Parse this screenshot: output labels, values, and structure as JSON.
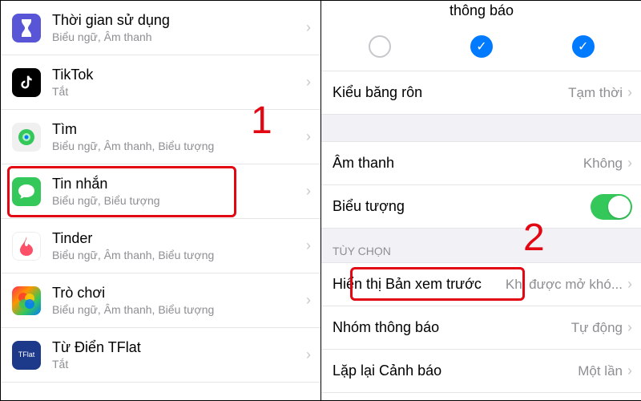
{
  "left": {
    "apps": [
      {
        "name": "Thời gian sử dụng",
        "sub": "Biểu ngữ, Âm thanh"
      },
      {
        "name": "TikTok",
        "sub": "Tắt"
      },
      {
        "name": "Tìm",
        "sub": "Biểu ngữ, Âm thanh, Biểu tượng"
      },
      {
        "name": "Tin nhắn",
        "sub": "Biểu ngữ, Biểu tượng"
      },
      {
        "name": "Tinder",
        "sub": "Biểu ngữ, Âm thanh, Biểu tượng"
      },
      {
        "name": "Trò chơi",
        "sub": "Biểu ngữ, Âm thanh, Biểu tượng"
      },
      {
        "name": "Từ Điển TFlat",
        "sub": "Tắt"
      }
    ]
  },
  "right": {
    "header": "thông báo",
    "banner_style_label": "Kiểu băng rôn",
    "banner_style_value": "Tạm thời",
    "sound_label": "Âm thanh",
    "sound_value": "Không",
    "badge_label": "Biểu tượng",
    "options_header": "TÙY CHỌN",
    "preview_label": "Hiển thị Bản xem trước",
    "preview_value": "Khi được mở khó...",
    "group_label": "Nhóm thông báo",
    "group_value": "Tự động",
    "repeat_label": "Lặp lại Cảnh báo",
    "repeat_value": "Một lần"
  },
  "steps": {
    "one": "1",
    "two": "2"
  }
}
